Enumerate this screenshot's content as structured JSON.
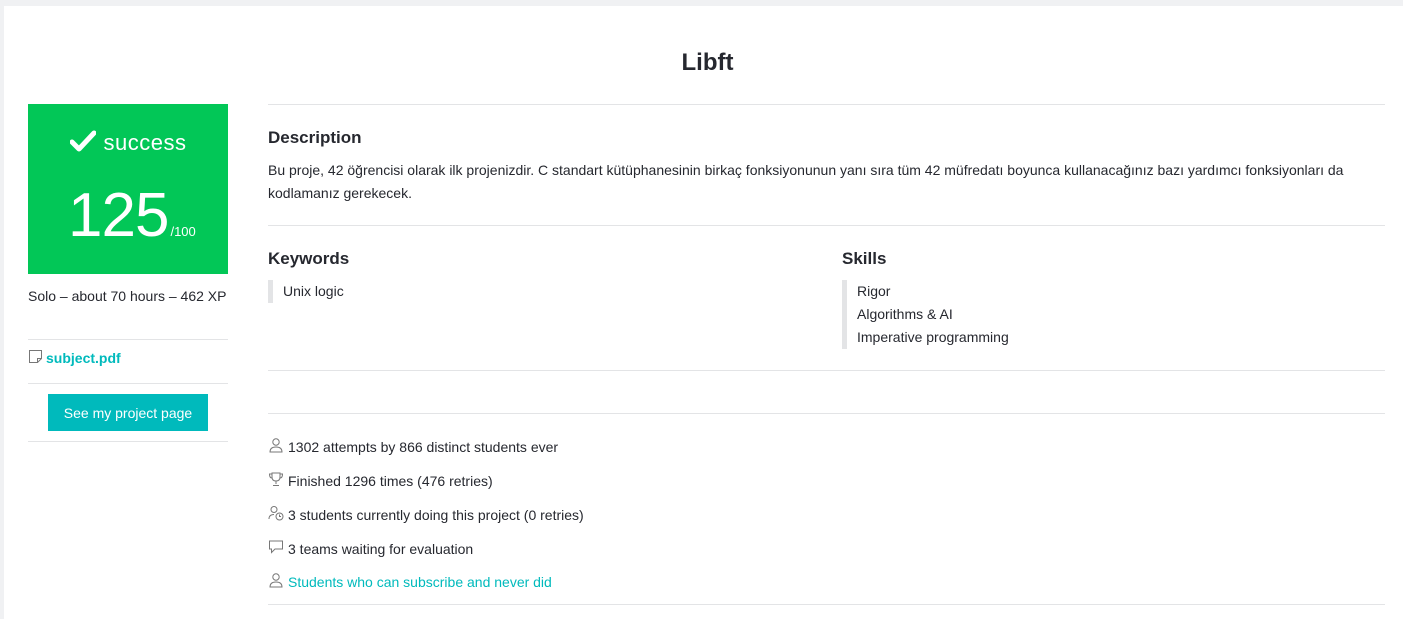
{
  "project": {
    "title": "Libft"
  },
  "result": {
    "status": "success",
    "score": "125",
    "max": "/100",
    "color": "#02c757"
  },
  "meta": {
    "summary": "Solo – about 70 hours – 462 XP",
    "subject_link": "subject.pdf",
    "subject_icon": "document-icon",
    "project_page_button": "See my project page"
  },
  "description": {
    "heading": "Description",
    "text": "Bu proje, 42 öğrencisi olarak ilk projenizdir. C standart kütüphanesinin birkaç fonksiyonunun yanı sıra tüm 42 müfredatı boyunca kullanacağınız bazı yardımcı fonksiyonları da kodlamanız gerekecek."
  },
  "keywords": {
    "heading": "Keywords",
    "items": [
      "Unix logic"
    ]
  },
  "skills": {
    "heading": "Skills",
    "items": [
      "Rigor",
      "Algorithms & AI",
      "Imperative programming"
    ]
  },
  "stats": [
    {
      "icon": "user-icon",
      "text": "1302 attempts by 866 distinct students ever"
    },
    {
      "icon": "trophy-icon",
      "text": "Finished 1296 times (476 retries)"
    },
    {
      "icon": "user-clock-icon",
      "text": "3 students currently doing this project (0 retries)"
    },
    {
      "icon": "chat-icon",
      "text": "3 teams waiting for evaluation"
    },
    {
      "icon": "user-icon",
      "text": "Students who can subscribe and never did"
    }
  ],
  "colors": {
    "accent": "#00babc",
    "success": "#02c757",
    "divider": "#e3e4e6"
  }
}
